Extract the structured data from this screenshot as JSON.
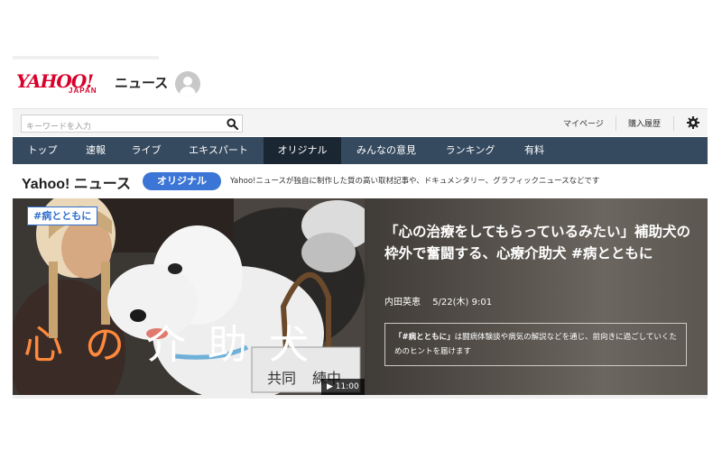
{
  "logo": {
    "yahoo": "YAHOO!",
    "japan": "JAPAN",
    "service": "ニュース"
  },
  "search": {
    "placeholder": "キーワードを入力",
    "value": ""
  },
  "header_links": {
    "mypage": "マイページ",
    "purchase": "購入履歴"
  },
  "nav": {
    "items": [
      {
        "label": "トップ",
        "active": false
      },
      {
        "label": "速報",
        "active": false
      },
      {
        "label": "ライブ",
        "active": false
      },
      {
        "label": "エキスパート",
        "active": false
      },
      {
        "label": "オリジナル",
        "active": true
      },
      {
        "label": "みんなの意見",
        "active": false
      },
      {
        "label": "ランキング",
        "active": false
      },
      {
        "label": "有料",
        "active": false
      }
    ]
  },
  "original": {
    "title": "Yahoo! ニュース",
    "badge": "オリジナル",
    "description": "Yahoo!ニュースが独自に制作した質の高い取材記事や、ドキュメンタリー、グラフィックニュースなどです"
  },
  "hero": {
    "tag": "#病とともに",
    "overlay_chars": [
      "心",
      "の",
      "介",
      "助",
      "犬"
    ],
    "duration": "▶ 11:00",
    "headline": "「心の治療をしてもらっているみたい」補助犬の枠外で奮闘する、心療介助犬 #病とともに",
    "author": "内田英恵",
    "date": "5/22(木) 9:01",
    "info_tag": "「#病とともに」",
    "info_text": "は闘病体験談や病気の解説などを通じ、前向きに過ごしていくためのヒントを届けます"
  },
  "colors": {
    "brand_red": "#d9002b",
    "nav_bg": "#35495f",
    "nav_active": "#1b2633",
    "badge_blue": "#3b75d6",
    "tag_blue": "#2f6fd0",
    "overlay_orange": "#ff8a3d"
  },
  "icons": {
    "search": "search-icon",
    "settings": "gear-icon",
    "avatar": "user-avatar-icon",
    "play": "play-icon"
  }
}
